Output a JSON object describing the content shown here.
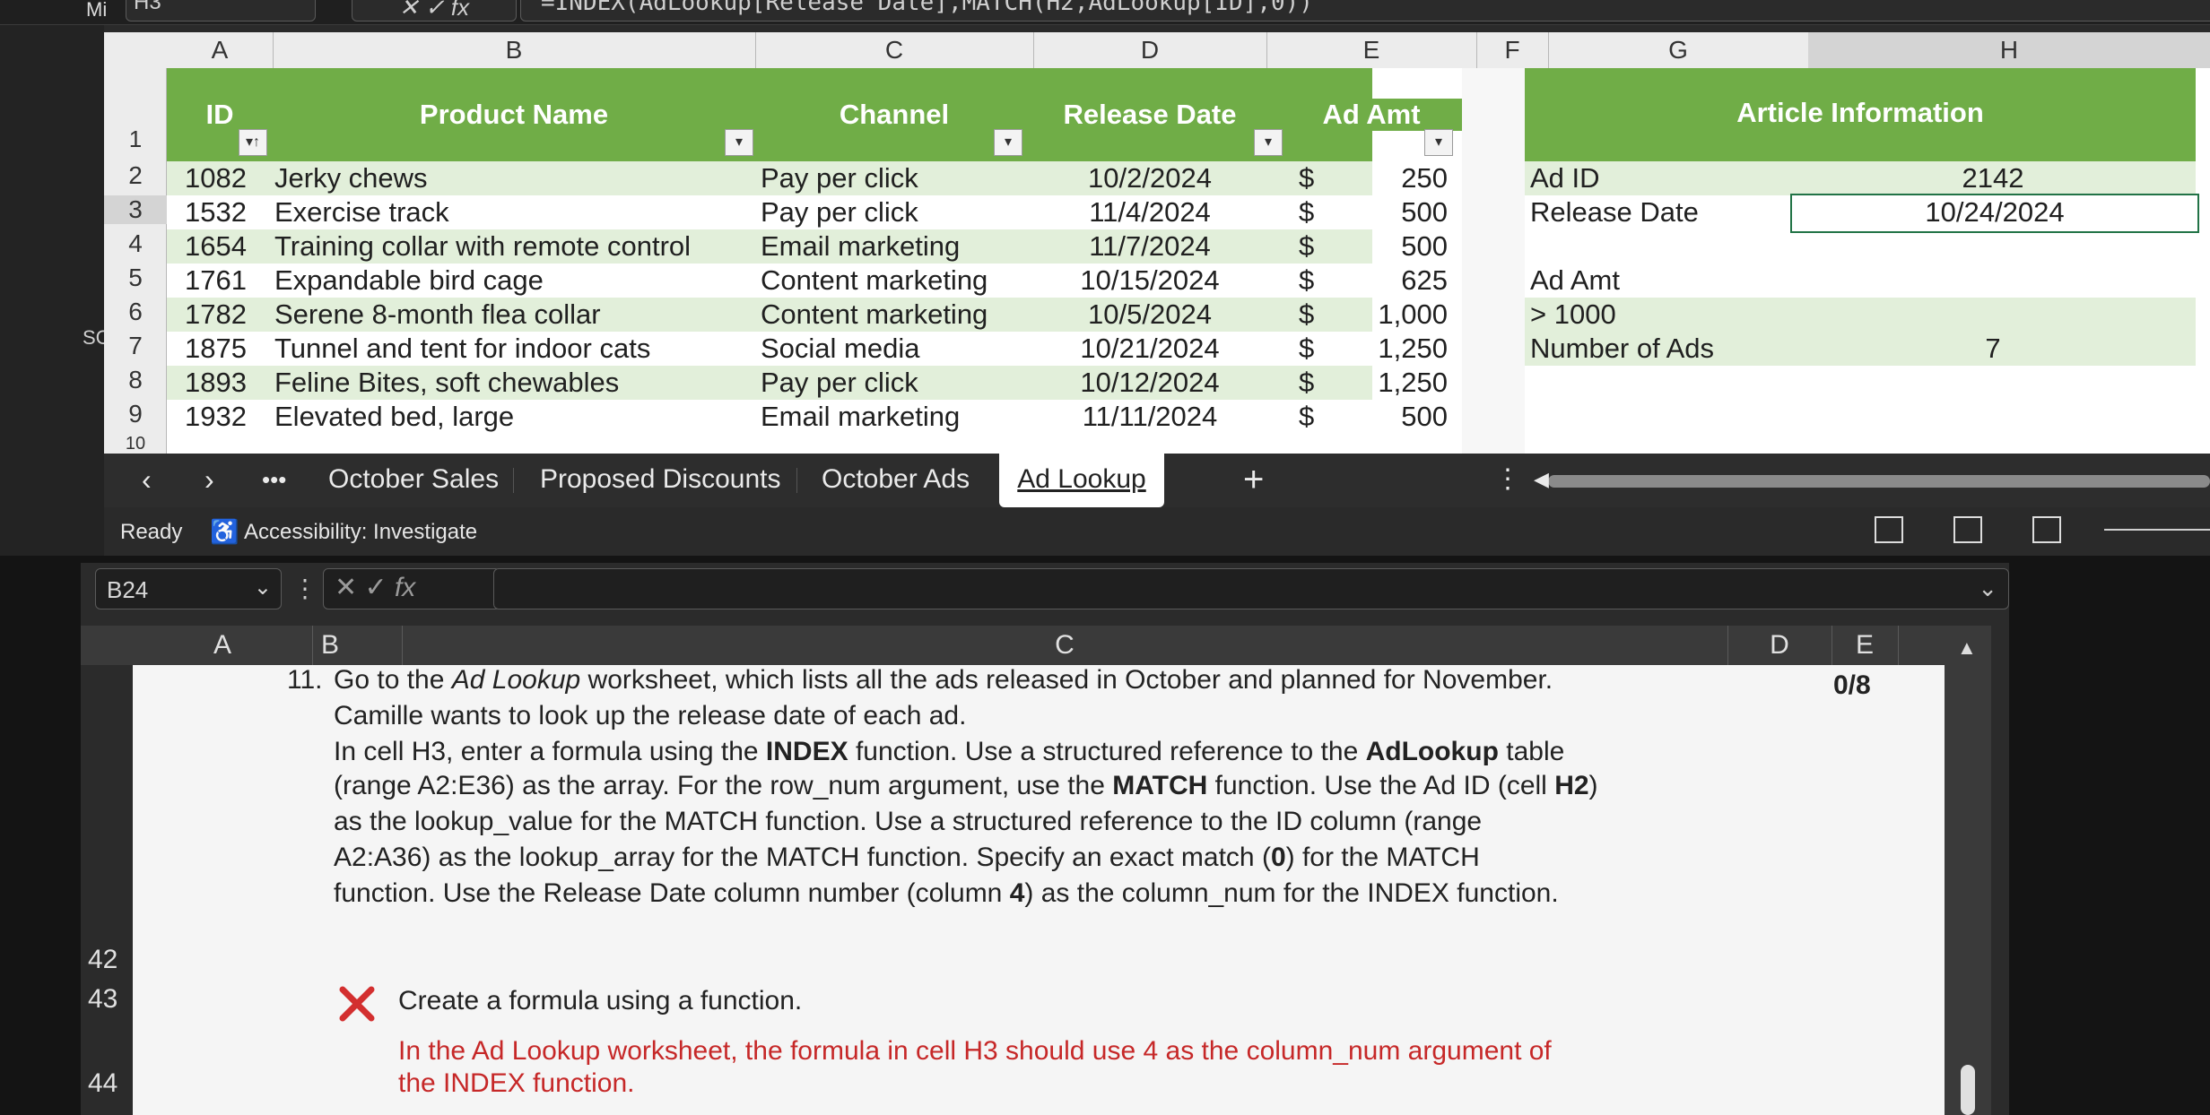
{
  "top_window": {
    "title_fragment": "Mi",
    "name_box": "H3",
    "formula": "=INDEX(AdLookup[Release Date],MATCH(H2,AdLookup[ID],0))",
    "column_headers": [
      "A",
      "B",
      "C",
      "D",
      "E",
      "F",
      "G",
      "H"
    ],
    "row_numbers": [
      "1",
      "2",
      "3",
      "4",
      "5",
      "6",
      "7",
      "8",
      "9",
      "10"
    ],
    "table_headers": {
      "id": "ID",
      "product_name": "Product Name",
      "channel": "Channel",
      "release_date": "Release Date",
      "ad_amt": "Ad Amt"
    },
    "rows": [
      {
        "id": "1082",
        "product": "Jerky chews",
        "channel": "Pay per click",
        "date": "10/2/2024",
        "currency": "$",
        "amt": "250"
      },
      {
        "id": "1532",
        "product": "Exercise track",
        "channel": "Pay per click",
        "date": "11/4/2024",
        "currency": "$",
        "amt": "500"
      },
      {
        "id": "1654",
        "product": "Training collar with remote control",
        "channel": "Email marketing",
        "date": "11/7/2024",
        "currency": "$",
        "amt": "500"
      },
      {
        "id": "1761",
        "product": "Expandable bird cage",
        "channel": "Content marketing",
        "date": "10/15/2024",
        "currency": "$",
        "amt": "625"
      },
      {
        "id": "1782",
        "product": "Serene 8-month flea collar",
        "channel": "Content marketing",
        "date": "10/5/2024",
        "currency": "$",
        "amt": "1,000"
      },
      {
        "id": "1875",
        "product": "Tunnel and tent for indoor cats",
        "channel": "Social media",
        "date": "10/21/2024",
        "currency": "$",
        "amt": "1,250"
      },
      {
        "id": "1893",
        "product": "Feline Bites, soft chewables",
        "channel": "Pay per click",
        "date": "10/12/2024",
        "currency": "$",
        "amt": "1,250"
      },
      {
        "id": "1932",
        "product": "Elevated bed, large",
        "channel": "Email marketing",
        "date": "11/11/2024",
        "currency": "$",
        "amt": "500"
      }
    ],
    "article_info": {
      "header": "Article Information",
      "ad_id_label": "Ad ID",
      "ad_id_value": "2142",
      "release_date_label": "Release Date",
      "release_date_value": "10/24/2024",
      "ad_amt_label": "Ad Amt",
      "ad_amt_criteria": "> 1000",
      "num_ads_label": "Number of Ads",
      "num_ads_value": "7"
    },
    "side_fragment": "SC",
    "sheet_tabs": [
      "October Sales",
      "Proposed Discounts",
      "October Ads",
      "Ad Lookup"
    ],
    "active_tab": "Ad Lookup",
    "status": {
      "ready": "Ready",
      "accessibility": "Accessibility: Investigate"
    }
  },
  "bottom_window": {
    "name_box": "B24",
    "column_headers": [
      "A",
      "B",
      "C",
      "D",
      "E"
    ],
    "row_numbers": [
      "42",
      "43",
      "44"
    ],
    "task": {
      "number": "11.",
      "line1_pre": "Go to the ",
      "line1_em": "Ad Lookup",
      "line1_post": " worksheet, which lists all the ads released in October and planned for November.",
      "line2": "Camille wants to look up the release date of each ad.",
      "line3_pre": "In cell H3, enter a formula using the ",
      "line3_b": "INDEX",
      "line3_mid": " function. Use a structured reference to the ",
      "line3_b2": "AdLookup",
      "line3_post": " table",
      "line4_pre": "(range A2:E36) as the array. For the row_num argument, use the ",
      "line4_b": "MATCH",
      "line4_mid": " function. Use the Ad ID (cell ",
      "line4_b2": "H2",
      "line4_post": ")",
      "line5": "as the lookup_value for the MATCH function. Use a structured reference to the ID column (range",
      "line6_pre": "A2:A36) as the lookup_array for the MATCH function. Specify an exact match (",
      "line6_b": "0",
      "line6_post": ") for the MATCH",
      "line7_pre": "function. Use the Release Date column number (column ",
      "line7_b": "4",
      "line7_post": ") as the column_num for the INDEX function."
    },
    "score": "0/8",
    "feedback": {
      "title": "Create a formula using a function.",
      "detail_line1": "In the Ad Lookup worksheet, the formula in cell H3 should use 4 as the column_num argument of",
      "detail_line2": "the INDEX function."
    }
  },
  "colors": {
    "table_header_green": "#70ad47",
    "band_light_green": "#e2efda",
    "error_red": "#c62828",
    "error_x": "#d32f2f"
  }
}
